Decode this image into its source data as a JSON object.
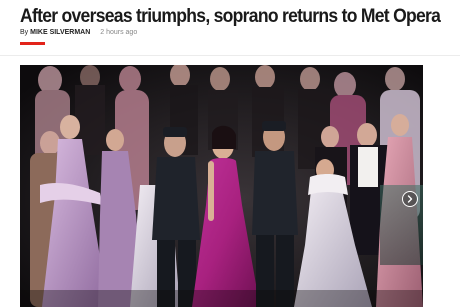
{
  "article": {
    "headline": "After overseas triumphs, soprano returns to Met Opera",
    "byline_prefix": "By",
    "author": "MIKE SILVERMAN",
    "timestamp": "2 hours ago"
  },
  "media": {
    "next_icon": "chevron-right-icon",
    "accent_color": "#e2231a"
  }
}
